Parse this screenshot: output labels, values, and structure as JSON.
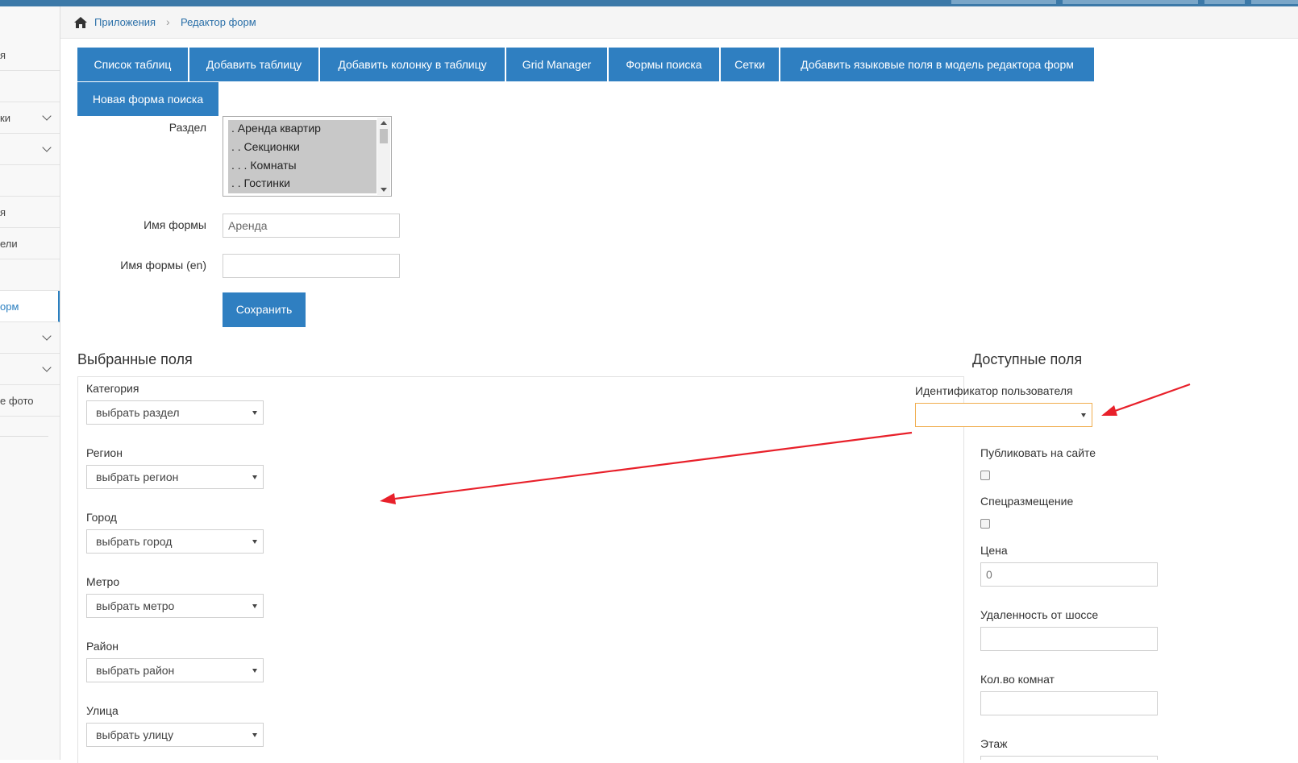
{
  "sidebar": {
    "items": [
      {
        "label": "я",
        "chevron": false
      },
      {
        "label": "",
        "chevron": false
      },
      {
        "label": "ки",
        "chevron": true
      },
      {
        "label": "",
        "chevron": true
      },
      {
        "label": "",
        "chevron": false
      },
      {
        "label": "я",
        "chevron": false
      },
      {
        "label": "ели",
        "chevron": false
      },
      {
        "label": "",
        "chevron": false
      },
      {
        "label": "орм",
        "chevron": false,
        "active": true
      },
      {
        "label": "",
        "chevron": true
      },
      {
        "label": "",
        "chevron": true
      },
      {
        "label": "е фото",
        "chevron": false
      }
    ]
  },
  "breadcrumb": {
    "home": "Приложения",
    "current": "Редактор форм"
  },
  "tabs": [
    "Список таблиц",
    "Добавить таблицу",
    "Добавить колонку в таблицу",
    "Grid Manager",
    "Формы поиска",
    "Сетки",
    "Добавить языковые поля в модель редактора форм",
    "Новая форма поиска"
  ],
  "form": {
    "section_label": "Раздел",
    "section_options": [
      ". Аренда квартир",
      ". . Секционки",
      ". . . Комнаты",
      ". . Гостинки"
    ],
    "name_label": "Имя формы",
    "name_value": "Аренда",
    "name_en_label": "Имя формы (en)",
    "name_en_value": "",
    "save_label": "Сохранить"
  },
  "selected": {
    "title": "Выбранные поля",
    "fields": [
      {
        "label": "Категория",
        "value": "выбрать раздел"
      },
      {
        "label": "Регион",
        "value": "выбрать регион"
      },
      {
        "label": "Город",
        "value": "выбрать город"
      },
      {
        "label": "Метро",
        "value": "выбрать метро"
      },
      {
        "label": "Район",
        "value": "выбрать район"
      },
      {
        "label": "Улица",
        "value": "выбрать улицу"
      }
    ]
  },
  "available": {
    "title": "Доступные поля",
    "user_id_label": "Идентификатор пользователя",
    "user_id_value": "",
    "publish_label": "Публиковать на сайте",
    "special_label": "Спецразмещение",
    "price_label": "Цена",
    "price_value": "0",
    "distance_label": "Удаленность от шоссе",
    "distance_value": "",
    "rooms_label": "Кол.во комнат",
    "rooms_value": "",
    "floor_label": "Этаж"
  },
  "colors": {
    "accent": "#2f7fc1",
    "arrow": "#e8202a",
    "focus": "#f0ad4e"
  }
}
